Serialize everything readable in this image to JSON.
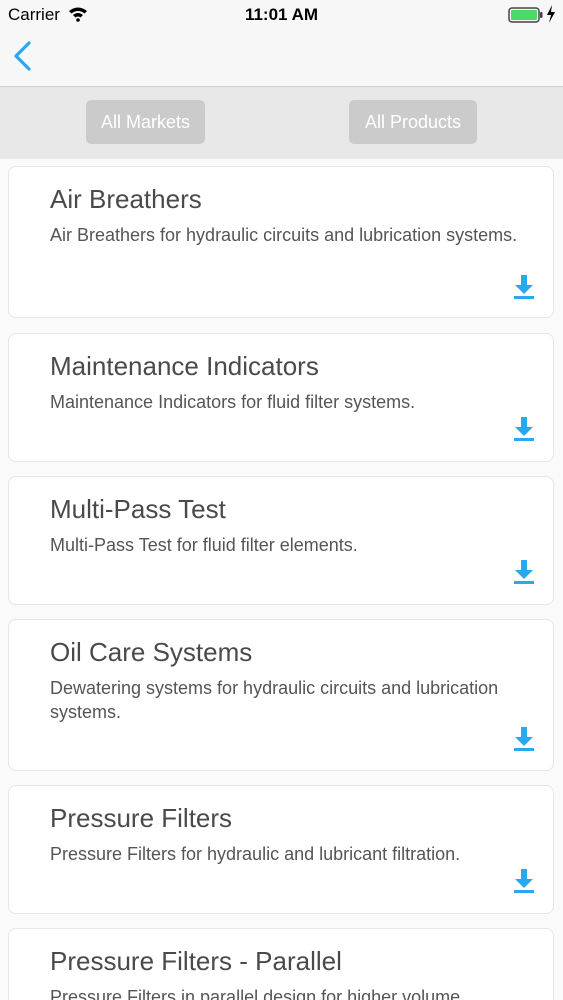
{
  "status": {
    "carrier": "Carrier",
    "time": "11:01 AM"
  },
  "filters": {
    "markets_label": "All Markets",
    "products_label": "All Products"
  },
  "colors": {
    "accent": "#29a8ee",
    "button_bg": "#cbcbcb"
  },
  "products": [
    {
      "title": "Air Breathers",
      "description": "Air Breathers for hydraulic circuits and lubrication systems."
    },
    {
      "title": "Maintenance Indicators",
      "description": "Maintenance Indicators for fluid filter systems."
    },
    {
      "title": "Multi-Pass Test",
      "description": "Multi-Pass Test for fluid filter elements."
    },
    {
      "title": "Oil Care Systems",
      "description": "Dewatering systems for hydraulic circuits and lubrication systems."
    },
    {
      "title": "Pressure Filters",
      "description": "Pressure Filters for hydraulic and lubricant filtration."
    },
    {
      "title": "Pressure Filters - Parallel",
      "description": "Pressure Filters in parallel design for higher volume"
    }
  ]
}
